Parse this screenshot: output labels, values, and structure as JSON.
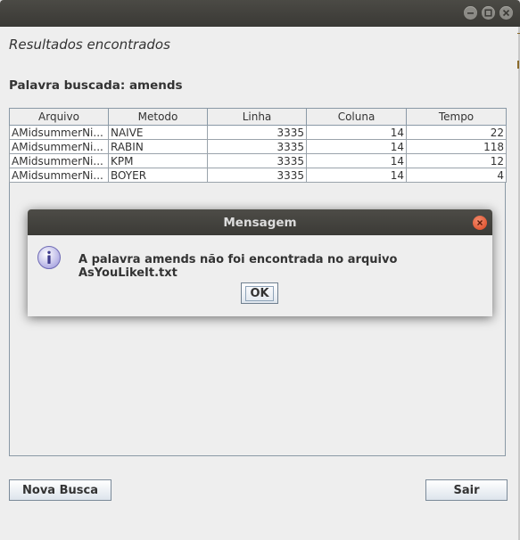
{
  "window": {
    "heading": "Resultados encontrados",
    "search_label": "Palavra buscada: amends"
  },
  "table": {
    "columns": [
      "Arquivo",
      "Metodo",
      "Linha",
      "Coluna",
      "Tempo"
    ],
    "rows": [
      [
        "AMidsummerNi...",
        "NAIVE",
        "3335",
        "14",
        "22"
      ],
      [
        "AMidsummerNi...",
        "RABIN",
        "3335",
        "14",
        "118"
      ],
      [
        "AMidsummerNi...",
        "KPM",
        "3335",
        "14",
        "12"
      ],
      [
        "AMidsummerNi...",
        "BOYER",
        "3335",
        "14",
        "4"
      ]
    ]
  },
  "buttons": {
    "new_search": "Nova Busca",
    "exit": "Sair"
  },
  "dialog": {
    "title": "Mensagem",
    "message": "A palavra amends não foi encontrada no arquivo AsYouLikeIt.txt",
    "ok_label": "OK",
    "icon": "info-icon"
  },
  "colors": {
    "titlebar": "#3e3d39",
    "background": "#eeeeee",
    "close_button": "#e2522d",
    "info_icon": "#a7a3e0"
  }
}
